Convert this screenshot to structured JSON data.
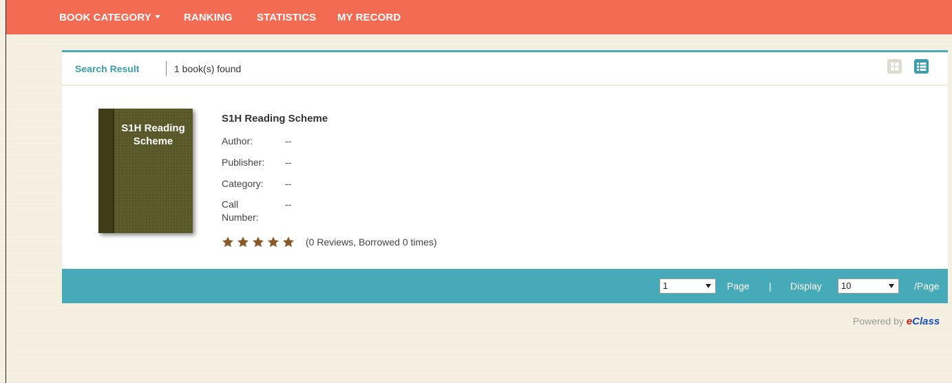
{
  "nav": {
    "items": [
      {
        "label": "BOOK CATEGORY"
      },
      {
        "label": "RANKING"
      },
      {
        "label": "STATISTICS"
      },
      {
        "label": "MY RECORD"
      }
    ]
  },
  "results": {
    "title": "Search Result",
    "count_text": "1 book(s) found"
  },
  "view_toggle": {
    "grid_icon": "grid-view-icon",
    "list_icon": "list-view-icon",
    "active": "list"
  },
  "book": {
    "cover_title": "S1H Reading Scheme",
    "title": "S1H Reading Scheme",
    "author_label": "Author:",
    "author_value": "--",
    "publisher_label": "Publisher:",
    "publisher_value": "--",
    "category_label": "Category:",
    "category_value": "--",
    "call_number_label": "Call Number:",
    "call_number_value": "--",
    "rating_stars": 5,
    "reviews_text": "(0 Reviews, Borrowed 0 times)"
  },
  "pagination": {
    "page_value": "1",
    "page_label": "Page",
    "separator": "|",
    "display_label": "Display",
    "per_page_value": "10",
    "per_page_suffix": "/Page"
  },
  "footer": {
    "powered_by": "Powered by",
    "brand_e": "e",
    "brand_rest": "Class"
  },
  "colors": {
    "nav_bg": "#f26b52",
    "accent": "#46aab9",
    "star": "#8b5a2b",
    "page_bg": "#f3eede"
  }
}
